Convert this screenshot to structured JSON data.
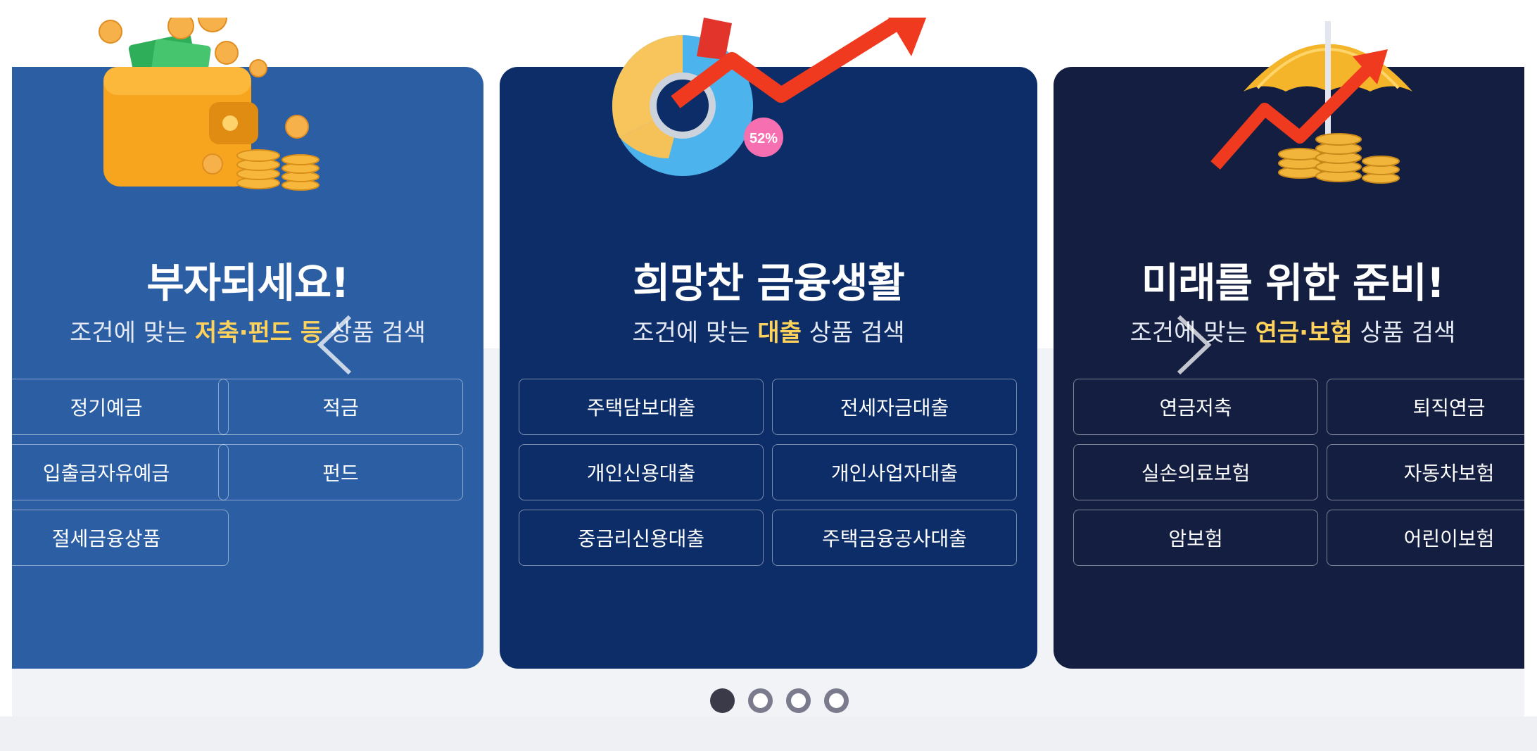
{
  "cards": [
    {
      "title": "부자되세요!",
      "subtitle_pre": "조건에 맞는 ",
      "subtitle_hl": "저축·펀드 등",
      "subtitle_post": " 상품 검색",
      "buttons": [
        "정기예금",
        "적금",
        "입출금자유예금",
        "펀드",
        "절세금융상품"
      ],
      "illustration": "wallet-coins-icon",
      "bg_color": "#2b5ea3"
    },
    {
      "title": "희망찬 금융생활",
      "subtitle_pre": "조건에 맞는 ",
      "subtitle_hl": "대출",
      "subtitle_post": " 상품 검색",
      "buttons": [
        "주택담보대출",
        "전세자금대출",
        "개인신용대출",
        "개인사업자대출",
        "중금리신용대출",
        "주택금융공사대출"
      ],
      "illustration": "pie-chart-arrow-icon",
      "badge": "52%",
      "bg_color": "#0c2d67"
    },
    {
      "title": "미래를 위한 준비!",
      "subtitle_pre": "조건에 맞는 ",
      "subtitle_hl": "연금·보험",
      "subtitle_post": " 상품 검색",
      "buttons": [
        "연금저축",
        "퇴직연금",
        "실손의료보험",
        "자동차보험",
        "암보험",
        "어린이보험"
      ],
      "illustration": "umbrella-coins-icon",
      "bg_color": "#141e40"
    }
  ],
  "carousel": {
    "prev_icon": "chevron-left-icon",
    "next_icon": "chevron-right-icon",
    "page_count": 4,
    "active_page": 1
  },
  "colors": {
    "highlight": "#ffd25c",
    "dot_active": "#3a3a48",
    "dot_inactive": "#7b7b8e"
  }
}
